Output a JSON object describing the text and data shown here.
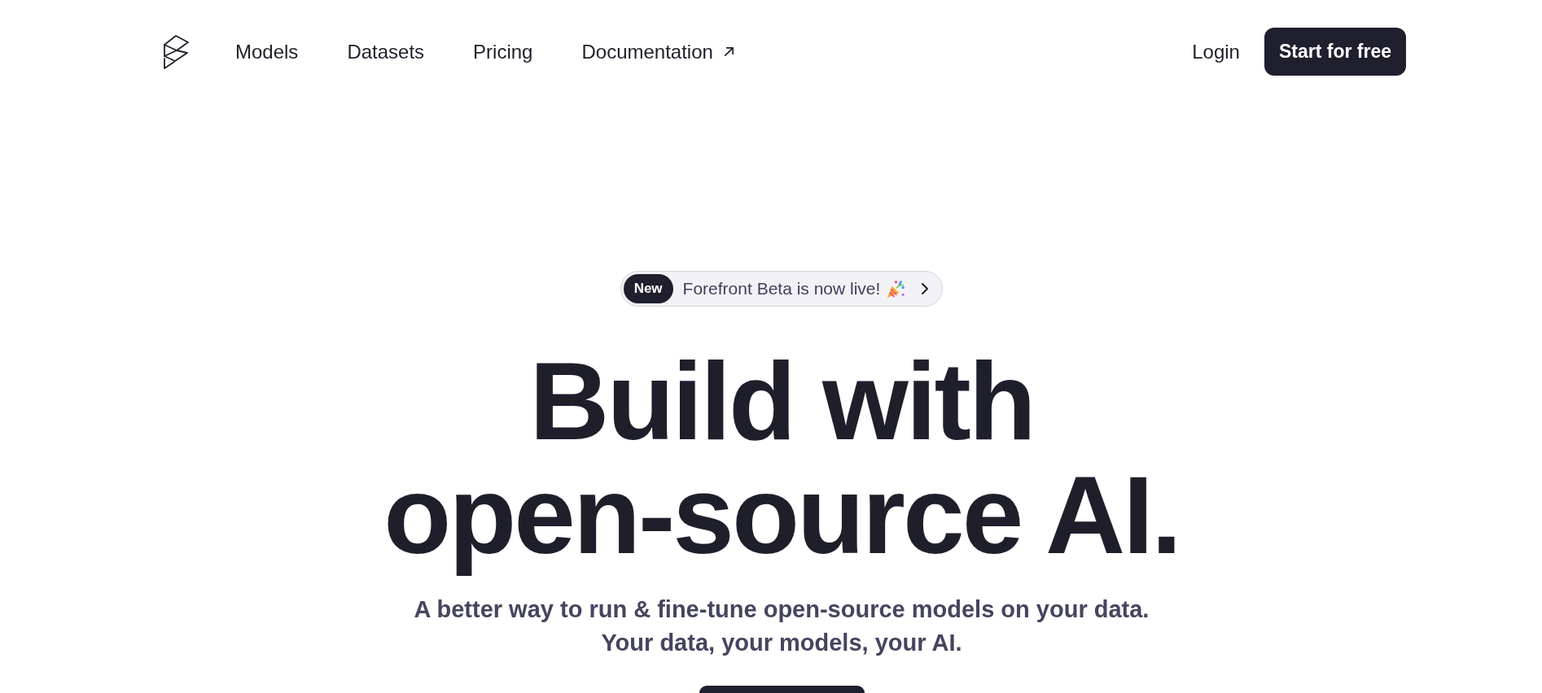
{
  "header": {
    "nav": [
      {
        "label": "Models",
        "external": false
      },
      {
        "label": "Datasets",
        "external": false
      },
      {
        "label": "Pricing",
        "external": false
      },
      {
        "label": "Documentation",
        "external": true
      }
    ],
    "login": "Login",
    "cta": "Start for free"
  },
  "hero": {
    "announcement": {
      "tag": "New",
      "text": "Forefront Beta is now live!"
    },
    "heading_lines": [
      "Build with",
      "open-source AI."
    ],
    "subtitle_lines": [
      "A better way to run & fine-tune open-source models on your data.",
      "Your data, your models, your AI."
    ]
  }
}
